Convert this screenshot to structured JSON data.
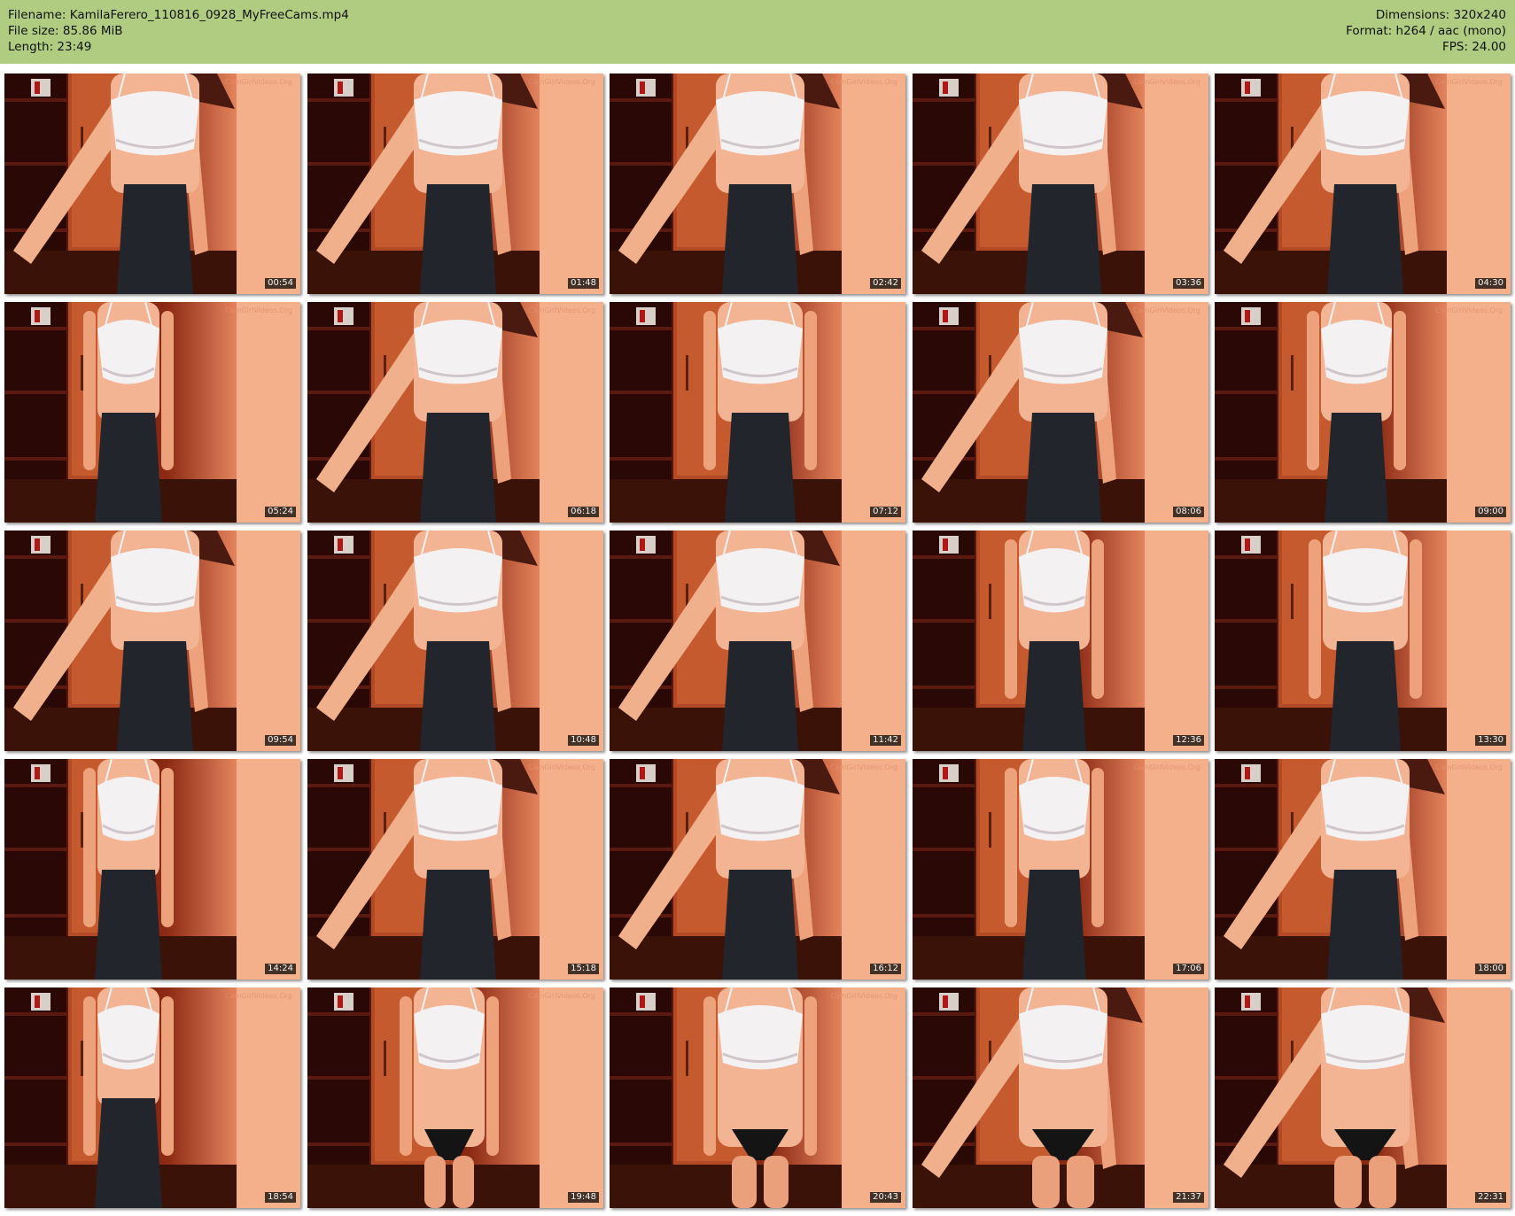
{
  "header": {
    "filename_line": "Filename: KamilaFerero_110816_0928_MyFreeCams.mp4",
    "filesize_line": "File size: 85.86 MiB",
    "length_line": "Length: 23:49",
    "dimensions_line": "Dimensions: 320x240",
    "format_line": "Format: h264 / aac (mono)",
    "fps_line": "FPS: 24.00"
  },
  "colors": {
    "header_bg": "#afcc80",
    "page_bg": "#ffffff",
    "timestamp_bg": "#000000"
  },
  "thumbnails": [
    {
      "time": "00:54",
      "pose": "lean-left",
      "bottom": "skirt",
      "watermark": "true"
    },
    {
      "time": "01:48",
      "pose": "lean-left",
      "bottom": "skirt",
      "watermark": "true"
    },
    {
      "time": "02:42",
      "pose": "lean-left",
      "bottom": "skirt",
      "watermark": "true"
    },
    {
      "time": "03:36",
      "pose": "lean-left",
      "bottom": "skirt",
      "watermark": "true"
    },
    {
      "time": "04:30",
      "pose": "lean-left",
      "bottom": "skirt",
      "watermark": "true"
    },
    {
      "time": "05:24",
      "pose": "side",
      "bottom": "skirt",
      "watermark": "true"
    },
    {
      "time": "06:18",
      "pose": "lean-left",
      "bottom": "skirt",
      "watermark": "true"
    },
    {
      "time": "07:12",
      "pose": "front",
      "bottom": "skirt",
      "watermark": "false"
    },
    {
      "time": "08:06",
      "pose": "lean-left",
      "bottom": "skirt",
      "watermark": "true"
    },
    {
      "time": "09:00",
      "pose": "front-small",
      "bottom": "skirt",
      "watermark": "true"
    },
    {
      "time": "09:54",
      "pose": "lean-left",
      "bottom": "skirt",
      "watermark": "false"
    },
    {
      "time": "10:48",
      "pose": "lean-left",
      "bottom": "skirt",
      "watermark": "false"
    },
    {
      "time": "11:42",
      "pose": "lean-left",
      "bottom": "skirt",
      "watermark": "false"
    },
    {
      "time": "12:36",
      "pose": "front-small",
      "bottom": "skirt",
      "watermark": "false"
    },
    {
      "time": "13:30",
      "pose": "front",
      "bottom": "skirt",
      "watermark": "false"
    },
    {
      "time": "14:24",
      "pose": "side",
      "bottom": "skirt",
      "watermark": "false"
    },
    {
      "time": "15:18",
      "pose": "lean-left",
      "bottom": "skirt",
      "watermark": "true"
    },
    {
      "time": "16:12",
      "pose": "lean-left",
      "bottom": "skirt",
      "watermark": "true"
    },
    {
      "time": "17:06",
      "pose": "front-small",
      "bottom": "skirt",
      "watermark": "true"
    },
    {
      "time": "18:00",
      "pose": "lean-left",
      "bottom": "skirt",
      "watermark": "true"
    },
    {
      "time": "18:54",
      "pose": "side",
      "bottom": "skirt",
      "watermark": "true"
    },
    {
      "time": "19:48",
      "pose": "front-small",
      "bottom": "briefs",
      "watermark": "true"
    },
    {
      "time": "20:43",
      "pose": "front",
      "bottom": "briefs",
      "watermark": "true"
    },
    {
      "time": "21:37",
      "pose": "lean-left",
      "bottom": "briefs",
      "watermark": "false"
    },
    {
      "time": "22:31",
      "pose": "lean-left",
      "bottom": "briefs",
      "watermark": "false"
    }
  ]
}
